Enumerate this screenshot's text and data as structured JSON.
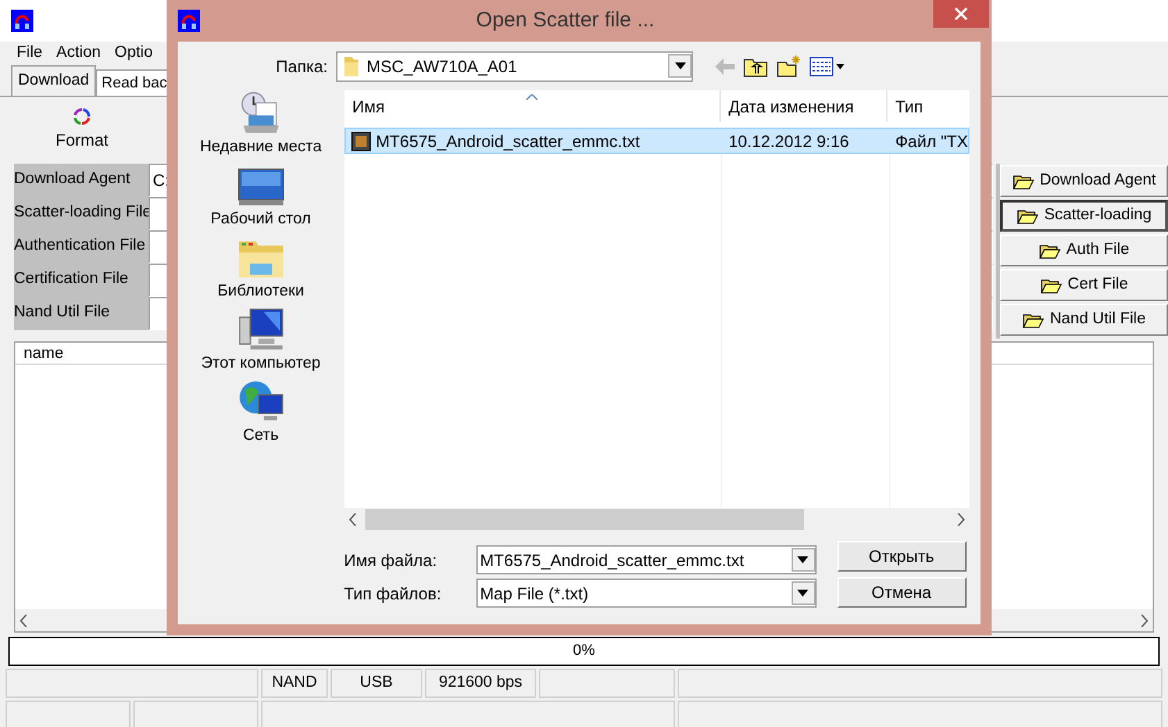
{
  "main_window": {
    "menu": [
      "File",
      "Action",
      "Optio"
    ],
    "tabs": [
      {
        "label": "Download",
        "selected": true
      },
      {
        "label": "Read bac",
        "selected": false
      }
    ],
    "toolbar": [
      {
        "label": "Format"
      }
    ],
    "file_fields": [
      {
        "label": "Download Agent",
        "value": "C:"
      },
      {
        "label": "Scatter-loading File"
      },
      {
        "label": "Authentication File"
      },
      {
        "label": "Certification File"
      },
      {
        "label": "Nand Util File"
      }
    ],
    "file_buttons": [
      {
        "label": "Download Agent",
        "focused": false
      },
      {
        "label": "Scatter-loading",
        "focused": true
      },
      {
        "label": "Auth File",
        "focused": false
      },
      {
        "label": "Cert File",
        "focused": false
      },
      {
        "label": "Nand Util File",
        "focused": false
      }
    ],
    "list": {
      "columns": [
        "name"
      ]
    },
    "progress": {
      "level": 0,
      "text": "0%"
    },
    "status_bar": [
      "NAND",
      "USB",
      "921600 bps"
    ]
  },
  "dialog": {
    "title": "Open Scatter file ...",
    "folder_label": "Папка:",
    "folder": "MSC_AW710A_A01",
    "places": [
      {
        "kind": "recent",
        "label": "Недавние места"
      },
      {
        "kind": "desktop",
        "label": "Рабочий стол"
      },
      {
        "kind": "libraries",
        "label": "Библиотеки"
      },
      {
        "kind": "computer",
        "label": "Этот компьютер"
      },
      {
        "kind": "network",
        "label": "Сеть"
      }
    ],
    "columns": [
      "Имя",
      "Дата изменения",
      "Тип"
    ],
    "files": [
      {
        "name": "MT6575_Android_scatter_emmc.txt",
        "date": "10.12.2012 9:16",
        "type": "Файл \"TX",
        "selected": true
      }
    ],
    "file_name_label": "Имя файла:",
    "file_name": "MT6575_Android_scatter_emmc.txt",
    "file_type_label": "Тип файлов:",
    "file_type": "Map File (*.txt)",
    "buttons": [
      "Открыть",
      "Отмена"
    ]
  }
}
